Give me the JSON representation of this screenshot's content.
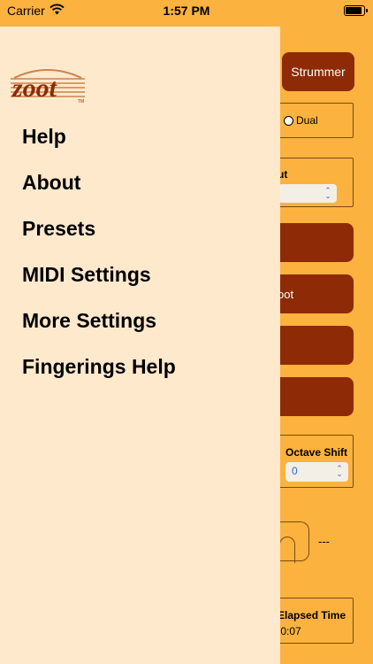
{
  "status_bar": {
    "carrier": "Carrier",
    "time": "1:57 PM"
  },
  "logo": {
    "text": "zoot",
    "tm": "TM"
  },
  "menu": {
    "items": [
      {
        "label": "Help"
      },
      {
        "label": "About"
      },
      {
        "label": "Presets"
      },
      {
        "label": "MIDI Settings"
      },
      {
        "label": "More Settings"
      },
      {
        "label": "Fingerings Help"
      }
    ]
  },
  "background": {
    "strummer_label": "Strummer",
    "dual_label": "Dual",
    "output_label": "ut",
    "button_label": "oot",
    "octave_shift_label": "Octave Shift",
    "octave_shift_value": "0",
    "dash_text": "---",
    "elapsed_time_label": "Elapsed Time",
    "elapsed_time_value": ":0:07"
  },
  "colors": {
    "accent": "#fcb23f",
    "button": "#8e2a06",
    "drawer": "#ffe9cd"
  }
}
